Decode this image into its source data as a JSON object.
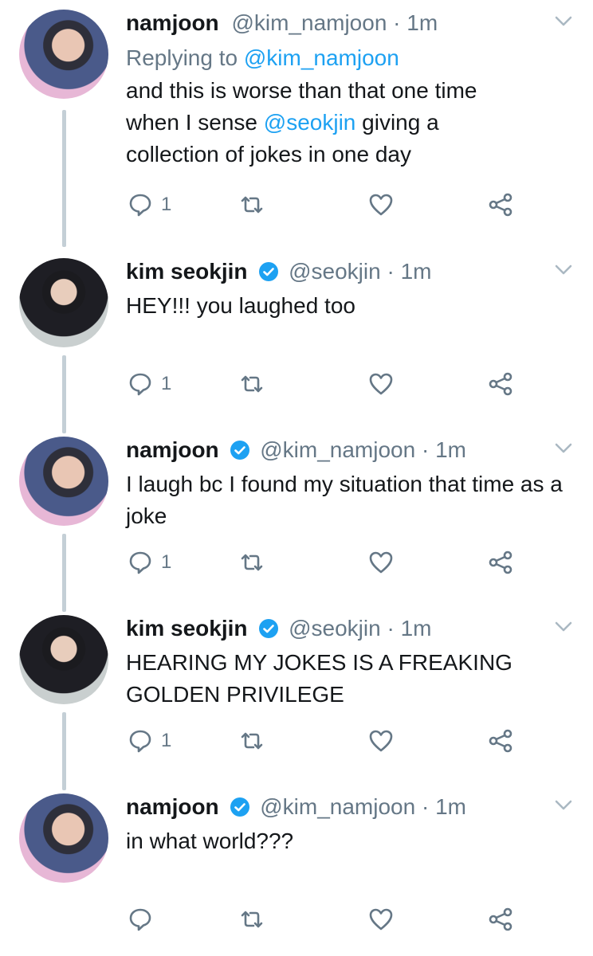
{
  "colors": {
    "link": "#1da1f2",
    "muted": "#657786",
    "text": "#14171a",
    "thread_line": "#c4cfd6"
  },
  "tweets": [
    {
      "name": "namjoon",
      "verified": false,
      "handle": "@kim_namjoon",
      "time": "1m",
      "replying_prefix": "Replying to ",
      "replying_handle": "@kim_namjoon",
      "text_a": "and this is worse than that one time when I sense ",
      "mention": "@seokjin",
      "text_b": " giving a collection of jokes in one day",
      "reply_count": "1"
    },
    {
      "name": "kim seokjin",
      "verified": true,
      "handle": "@seokjin",
      "time": "1m",
      "text": "HEY!!! you laughed too",
      "reply_count": "1"
    },
    {
      "name": "namjoon",
      "verified": true,
      "handle": "@kim_namjoon",
      "time": "1m",
      "text": "I laugh bc I found my situation that time as a joke",
      "reply_count": "1"
    },
    {
      "name": "kim seokjin",
      "verified": true,
      "handle": "@seokjin",
      "time": "1m",
      "text": "HEARING MY JOKES IS A FREAKING GOLDEN PRIVILEGE",
      "reply_count": "1"
    },
    {
      "name": "namjoon",
      "verified": true,
      "handle": "@kim_namjoon",
      "time": "1m",
      "text": "in what world???",
      "reply_count": ""
    }
  ],
  "separator": " · ",
  "icons": {
    "reply": "speech-bubble-icon",
    "retweet": "retweet-icon",
    "like": "heart-icon",
    "share": "share-icon",
    "menu": "chevron-down-icon",
    "verified": "verified-badge-icon"
  }
}
